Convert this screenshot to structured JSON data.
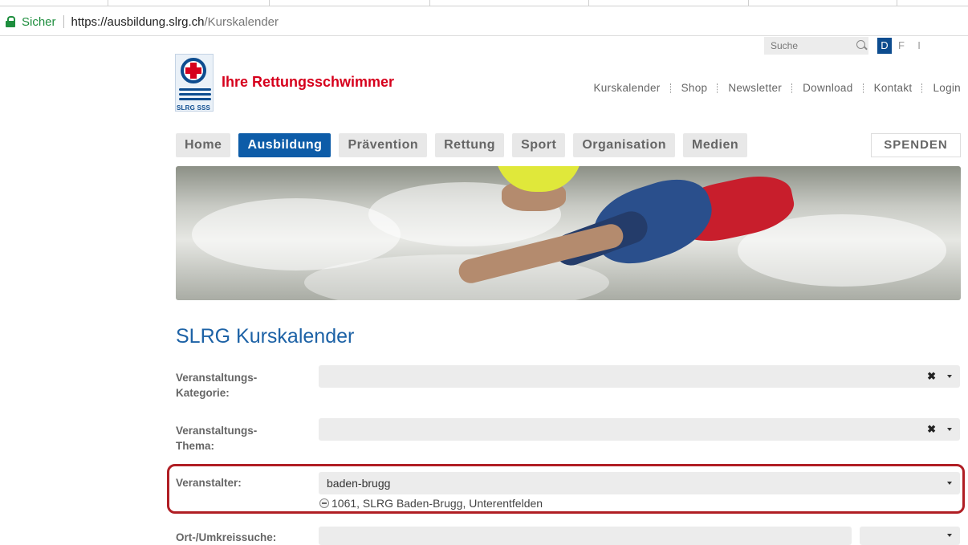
{
  "browser": {
    "secure_label": "Sicher",
    "url_host": "https://ausbildung.slrg.ch",
    "url_path": "/Kurskalender"
  },
  "header": {
    "search_placeholder": "Suche",
    "languages": [
      "D",
      "F",
      "I"
    ],
    "active_language": "D",
    "logo_text": "SLRG SSS",
    "tagline": "Ihre Rettungsschwimmer",
    "top_links": [
      "Kurskalender",
      "Shop",
      "Newsletter",
      "Download",
      "Kontakt",
      "Login"
    ]
  },
  "main_nav": {
    "items": [
      "Home",
      "Ausbildung",
      "Prävention",
      "Rettung",
      "Sport",
      "Organisation",
      "Medien"
    ],
    "active": "Ausbildung",
    "donate_label": "SPENDEN"
  },
  "page": {
    "title": "SLRG Kurskalender"
  },
  "form": {
    "kategorie": {
      "label_line1": "Veranstaltungs-",
      "label_line2": "Kategorie:",
      "value": ""
    },
    "thema": {
      "label_line1": "Veranstaltungs-",
      "label_line2": "Thema:",
      "value": ""
    },
    "veranstalter": {
      "label": "Veranstalter:",
      "value": "baden-brugg",
      "selected_option": "1061, SLRG Baden-Brugg, Unterentfelden"
    },
    "ort": {
      "label": "Ort-/Umkreissuche:",
      "value": ""
    }
  },
  "colors": {
    "brand_blue": "#0d5ca8",
    "brand_red": "#d6001c",
    "title_blue": "#1d62a6",
    "highlight_red": "#b01e24"
  }
}
